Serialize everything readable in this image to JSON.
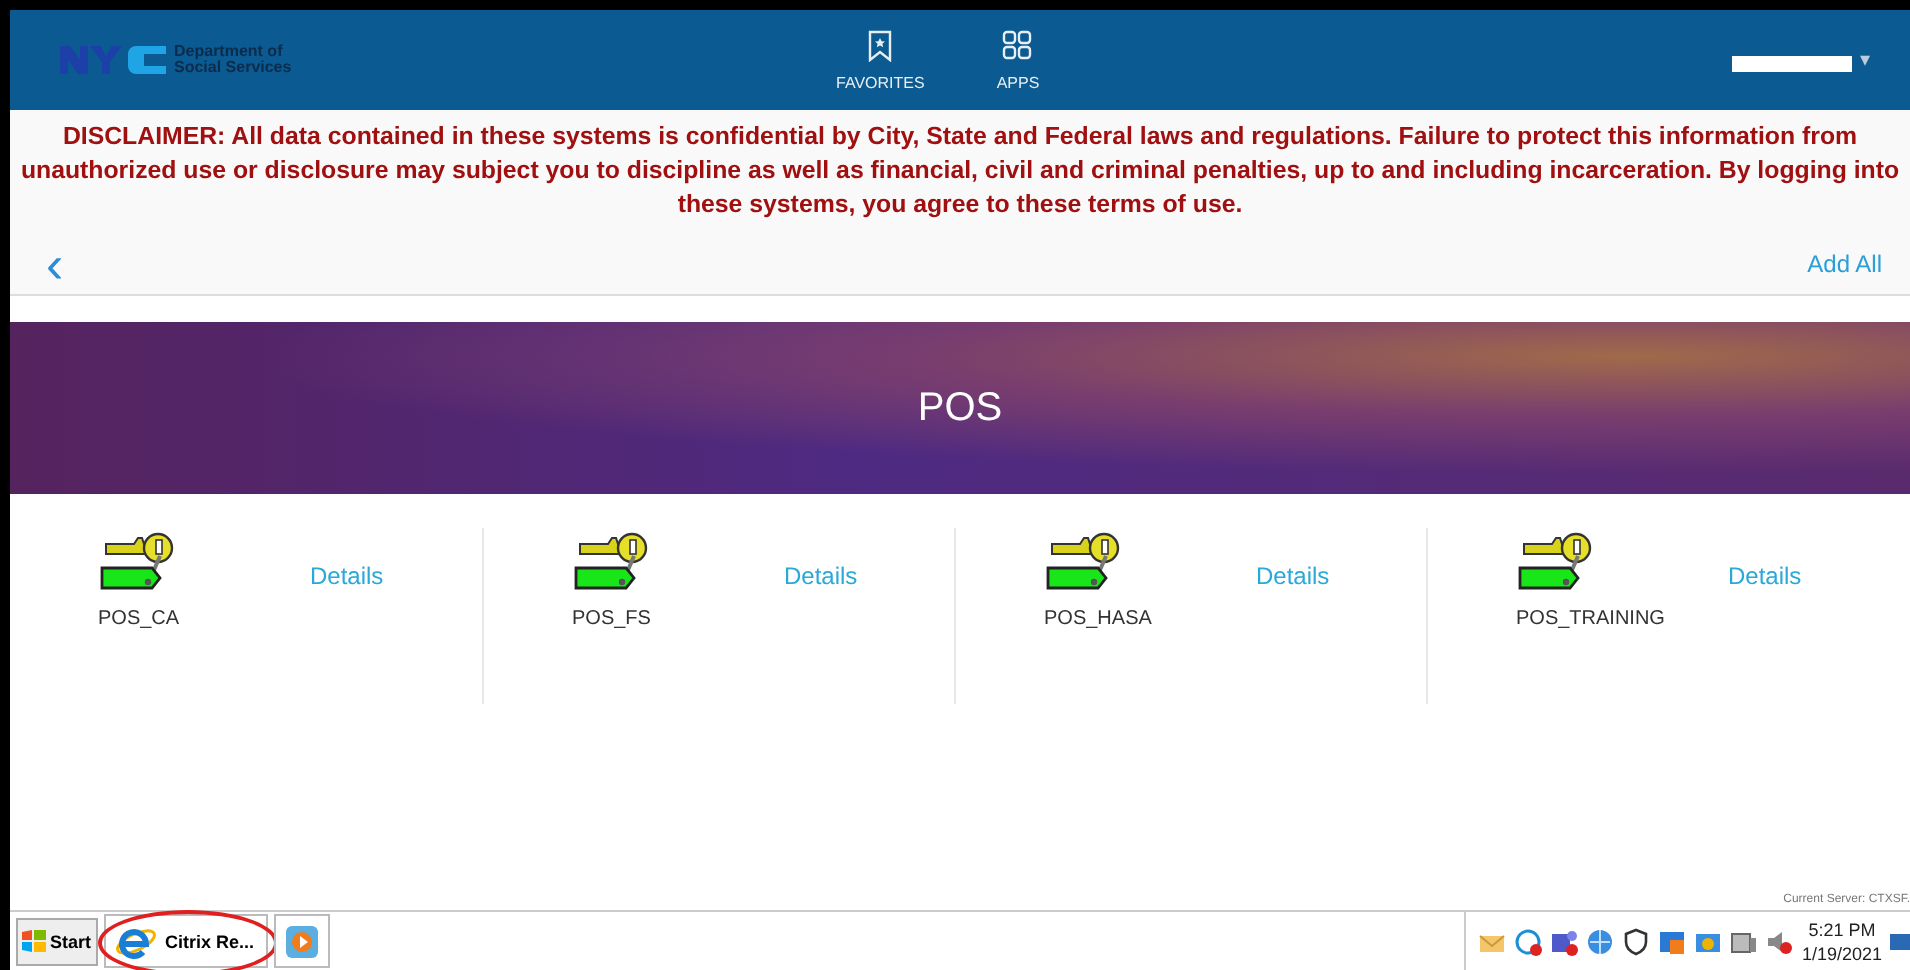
{
  "header": {
    "logo_text": "Department of\nSocial Services",
    "nav": [
      {
        "label": "FAVORITES",
        "kind": "bookmark",
        "selected": false
      },
      {
        "label": "APPS",
        "kind": "grid",
        "selected": false
      }
    ],
    "user_caret": "▾"
  },
  "disclaimer": "DISCLAIMER: All data contained in these systems is confidential by City, State and Federal laws and regulations. Failure to protect this information from unauthorized use or disclosure may subject you to discipline as well as financial, civil and criminal penalties, up to and including incarceration. By logging into these systems, you agree to these terms of use.",
  "toolbar": {
    "back": "‹",
    "add_all": "Add All"
  },
  "banner": {
    "title": "POS"
  },
  "apps": [
    {
      "name": "POS_CA",
      "link": "Details"
    },
    {
      "name": "POS_FS",
      "link": "Details"
    },
    {
      "name": "POS_HASA",
      "link": "Details"
    },
    {
      "name": "POS_TRAINING",
      "link": "Details"
    }
  ],
  "server_note": "Current Server: CTXSF.",
  "taskbar": {
    "start": "Start",
    "tasks": [
      {
        "label": "Citrix Re...",
        "kind": "browser",
        "highlighted": true
      },
      {
        "kind": "media",
        "highlighted": false
      }
    ],
    "time": "5:21 PM",
    "date": "1/19/2021"
  }
}
